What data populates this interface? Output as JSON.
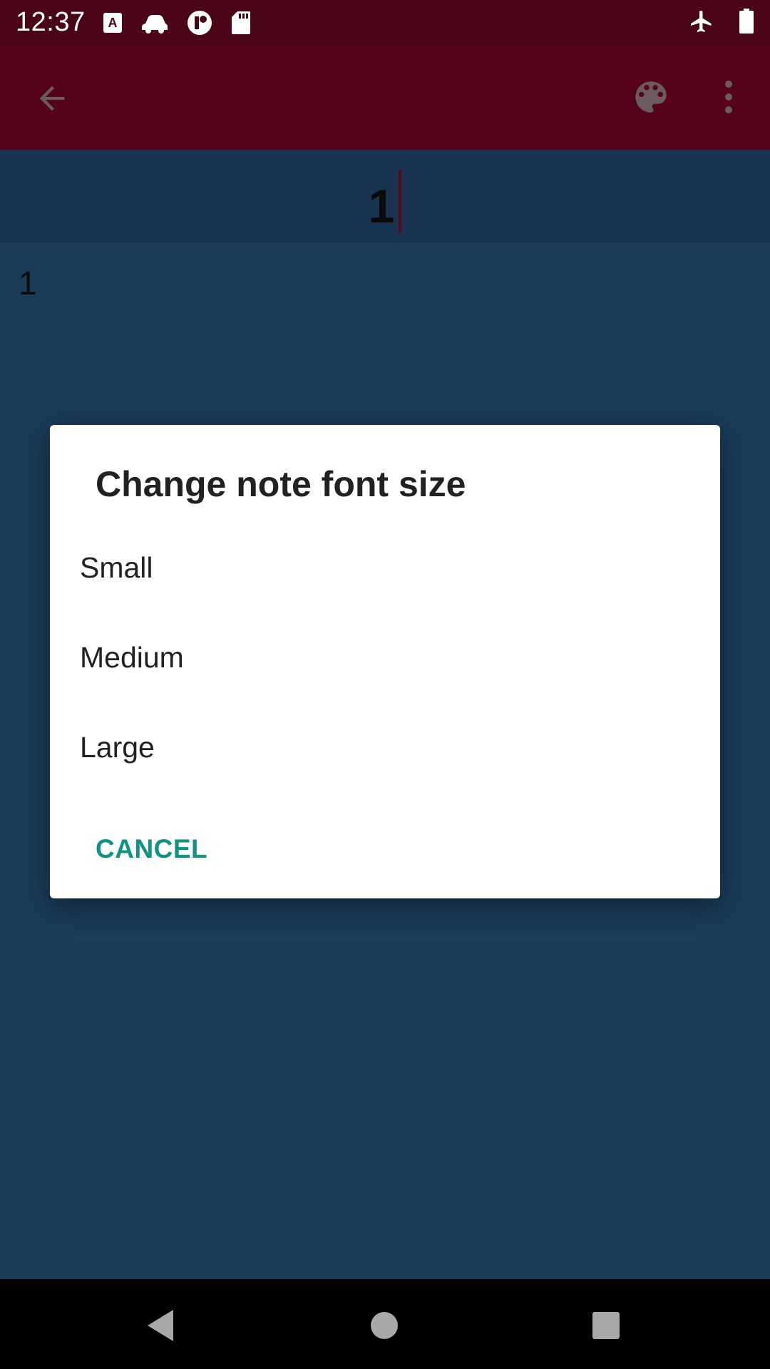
{
  "status_bar": {
    "time": "12:37",
    "left_icons": [
      "a-accessibility-icon",
      "car-icon",
      "app-circle-icon",
      "sd-card-icon"
    ],
    "right_icons": [
      "airplane-mode-icon",
      "battery-icon"
    ]
  },
  "toolbar": {
    "icons": [
      "back-arrow-icon",
      "palette-icon",
      "more-vert-icon"
    ]
  },
  "note": {
    "title": "1",
    "body": "1"
  },
  "dialog": {
    "title": "Change note font size",
    "options": [
      {
        "label": "Small"
      },
      {
        "label": "Medium"
      },
      {
        "label": "Large"
      }
    ],
    "cancel_label": "CANCEL"
  },
  "colors": {
    "status_bar": "#4a0617",
    "toolbar": "#560219",
    "title_bar": "#1b3856",
    "content_bg": "#1c405f",
    "accent": "#0e9384"
  }
}
